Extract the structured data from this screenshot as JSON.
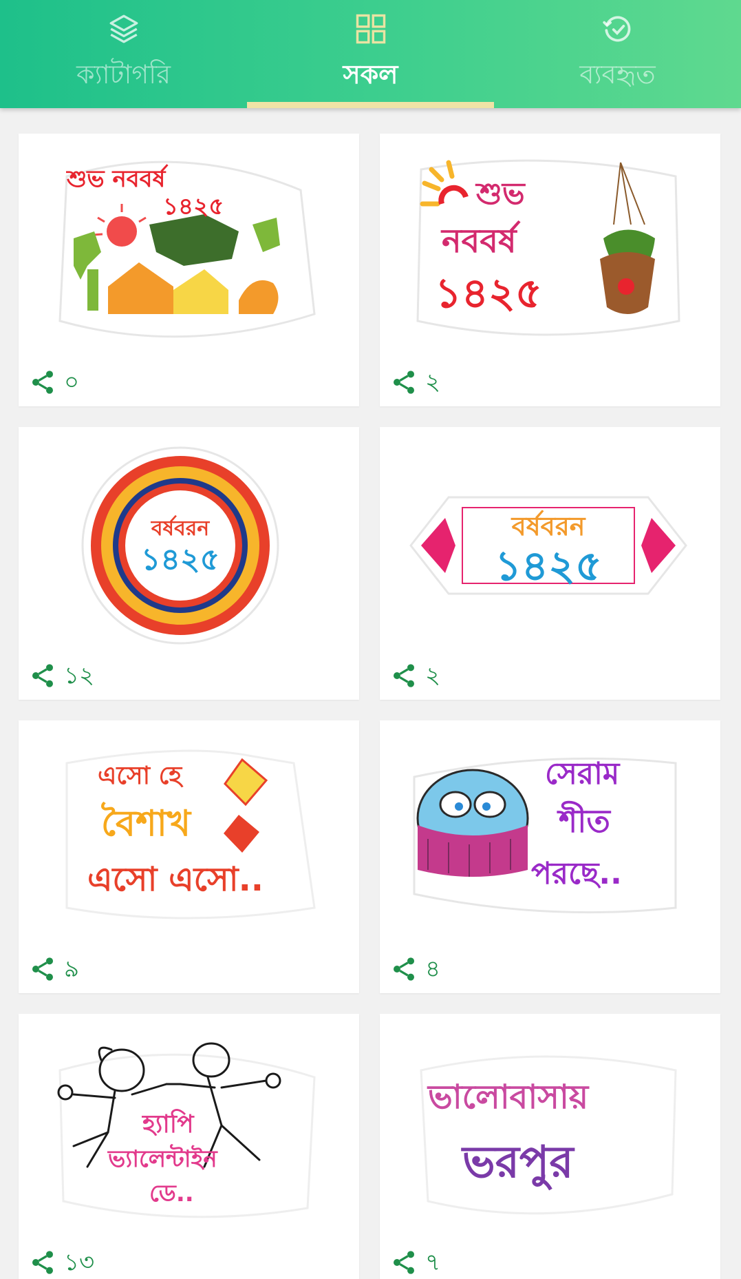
{
  "tabs": [
    {
      "label": "ক্যাটাগরি",
      "icon": "layers-icon",
      "active": false
    },
    {
      "label": "সকল",
      "icon": "grid-icon",
      "active": true
    },
    {
      "label": "ব্যবহৃত",
      "icon": "history-clock-icon",
      "active": false
    }
  ],
  "colors": {
    "header_start": "#1ec08a",
    "header_end": "#5fd98f",
    "indicator": "#efe3a6",
    "share_icon": "#1f8f4a",
    "count_text": "#1f8f4a"
  },
  "stickers": [
    {
      "text_lines": [
        "শুভ নববর্ষ",
        "১৪২৫"
      ],
      "share_count": "০"
    },
    {
      "text_lines": [
        "শুভ",
        "নববর্ষ",
        "১৪২৫"
      ],
      "share_count": "২"
    },
    {
      "text_lines": [
        "বর্ষবরন",
        "১৪২৫"
      ],
      "share_count": "১২"
    },
    {
      "text_lines": [
        "বর্ষবরন",
        "১৪২৫"
      ],
      "share_count": "২"
    },
    {
      "text_lines": [
        "এসো হে",
        "বৈশাখ",
        "এসো এসো.."
      ],
      "share_count": "৯"
    },
    {
      "text_lines": [
        "সেরাম",
        "শীত",
        "পরছে.."
      ],
      "share_count": "৪"
    },
    {
      "text_lines": [
        "হ্যাপি",
        "ভ্যালেন্টাইন",
        "ডে.."
      ],
      "share_count": "১৩"
    },
    {
      "text_lines": [
        "ভালোবাসায়",
        "ভরপুর"
      ],
      "share_count": "৭"
    }
  ]
}
